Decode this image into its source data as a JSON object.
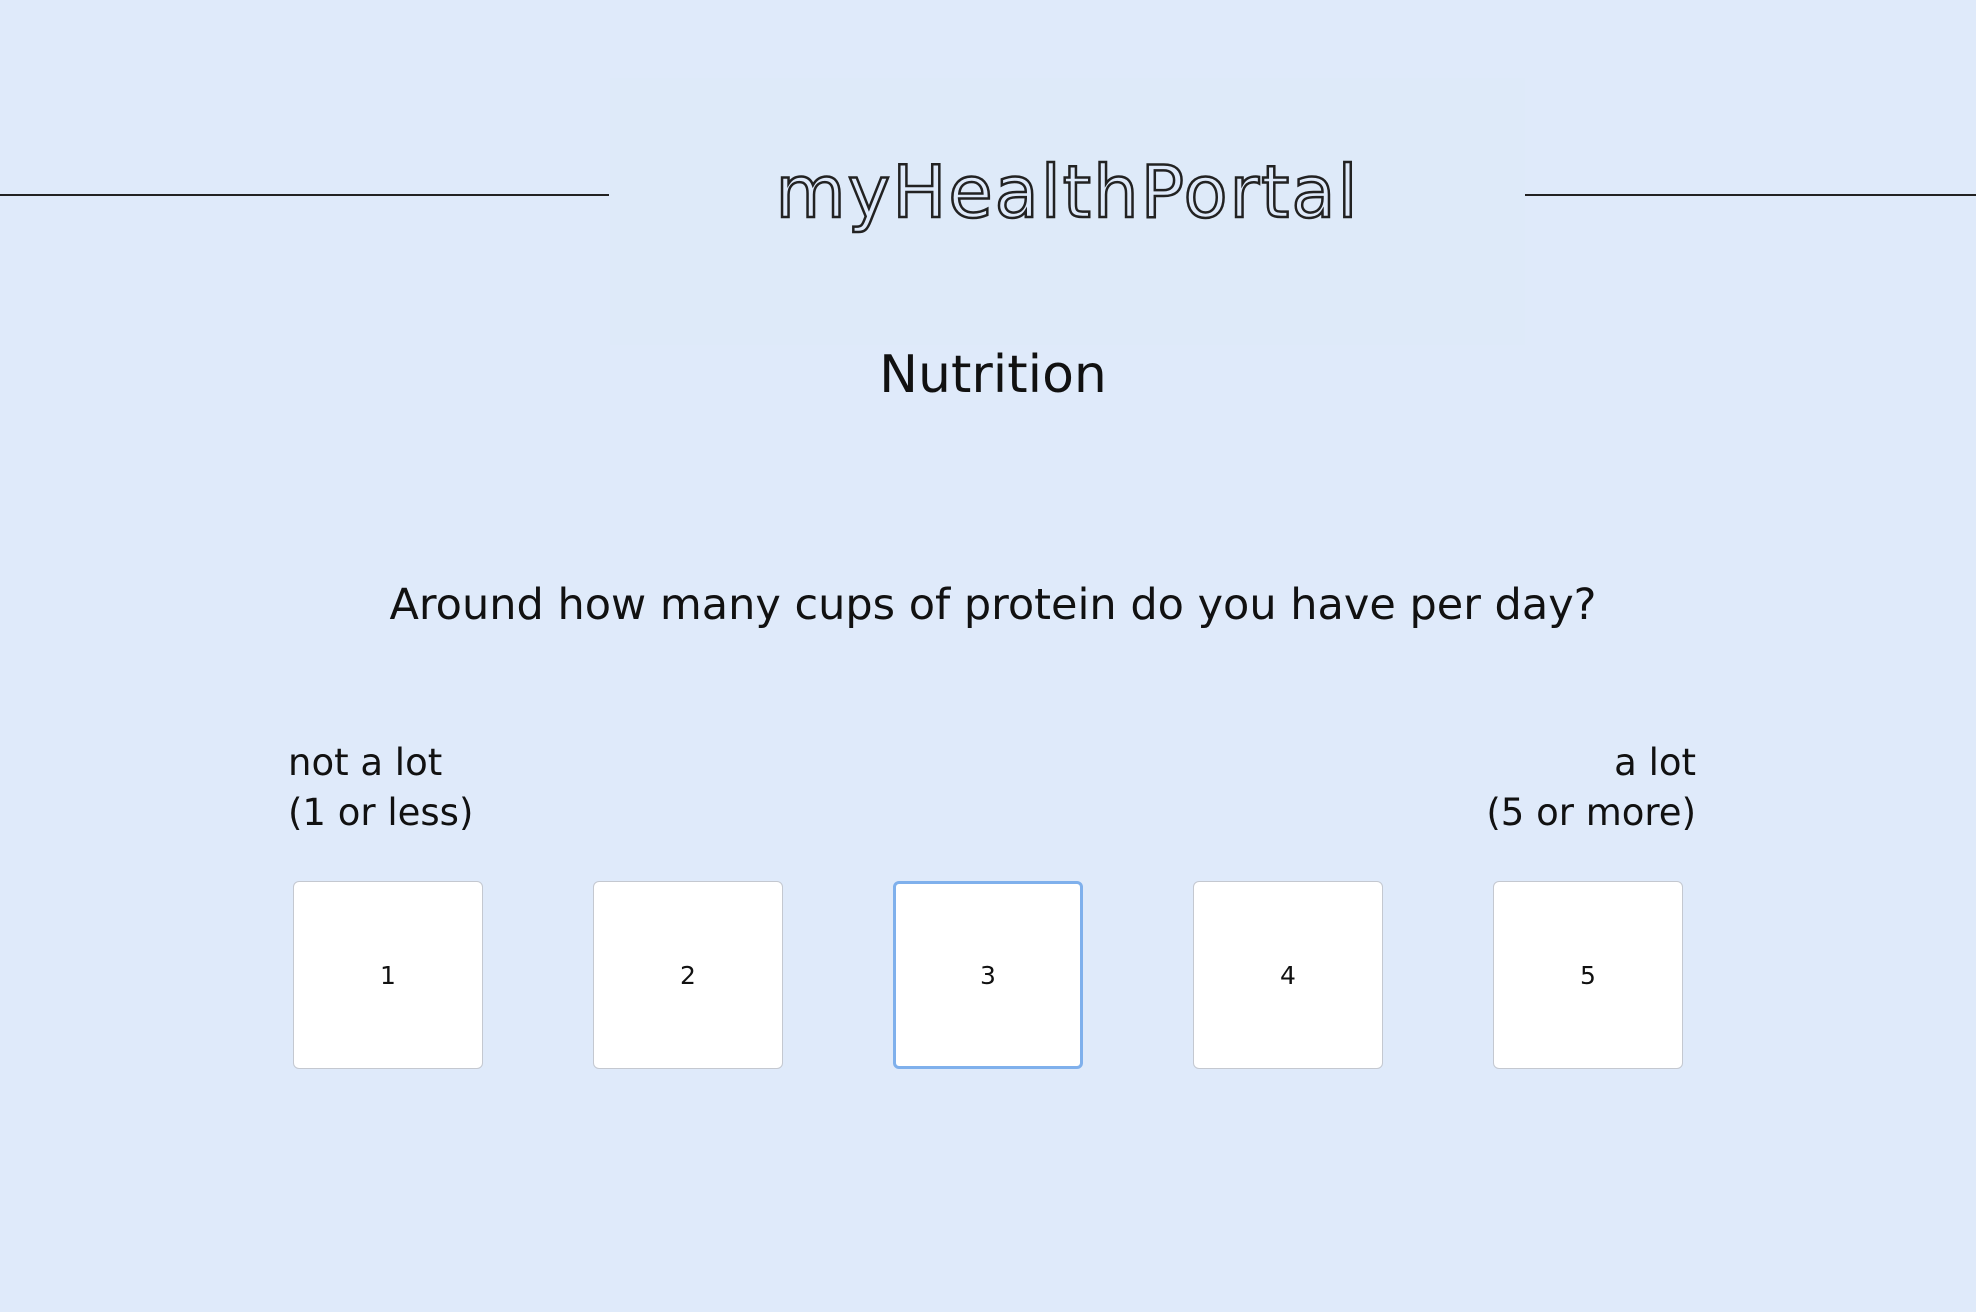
{
  "header": {
    "logo": "myHealthPortal"
  },
  "page": {
    "title": "Nutrition"
  },
  "question": {
    "text": "Around how many cups of protein do you have per day?",
    "scale_low_label": "not a lot",
    "scale_low_sub": "(1 or less)",
    "scale_high_label": "a lot",
    "scale_high_sub": "(5 or more)",
    "options": [
      "1",
      "2",
      "3",
      "4",
      "5"
    ],
    "selected": "3"
  },
  "colors": {
    "background": "#dfeafa",
    "selected_border": "#7fb0ec"
  }
}
